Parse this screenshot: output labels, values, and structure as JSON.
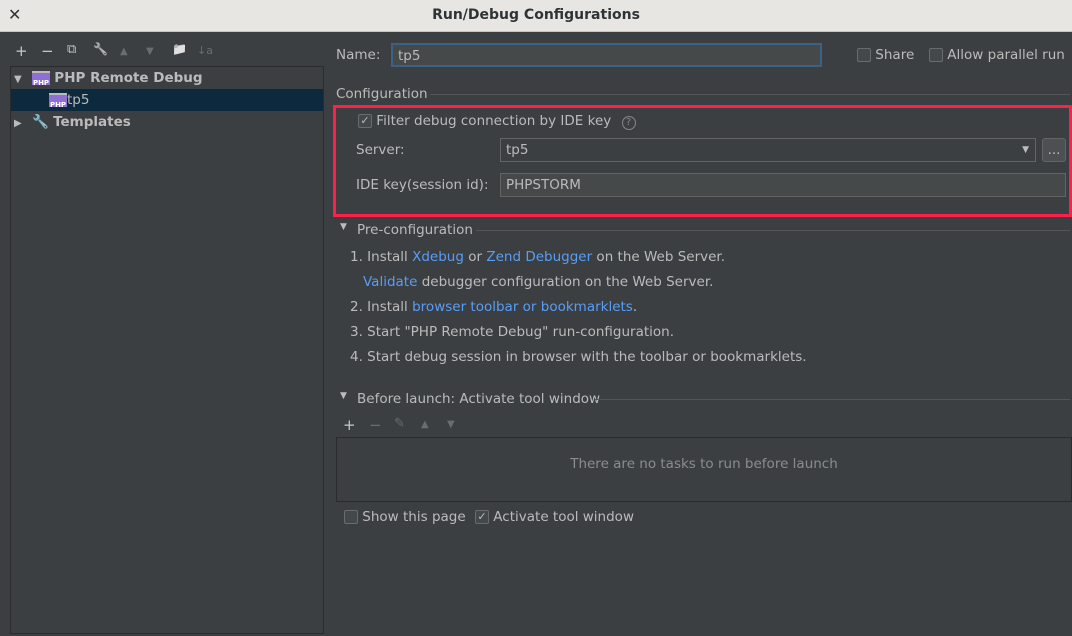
{
  "window": {
    "title": "Run/Debug Configurations"
  },
  "toolbar": {
    "add": "+",
    "remove": "−",
    "copy": "⧉",
    "edit": "🔧",
    "up": "▲",
    "down": "▼",
    "folder": "📁",
    "sort": "↓a"
  },
  "tree": {
    "group": "PHP Remote Debug",
    "item": "tp5",
    "templates": "Templates"
  },
  "name": {
    "label": "Name:",
    "value": "tp5"
  },
  "share": {
    "label": "Share",
    "checked": false
  },
  "parallel": {
    "label": "Allow parallel run",
    "checked": false
  },
  "configuration": {
    "title": "Configuration",
    "filter_label": "Filter debug connection by IDE key",
    "filter_checked": true,
    "server_label": "Server:",
    "server_value": "tp5",
    "more": "...",
    "idekey_label": "IDE key(session id):",
    "idekey_value": "PHPSTORM",
    "highlight_color": "#ff1f4b"
  },
  "preconfig": {
    "title": "Pre-configuration",
    "s1a": "1. Install ",
    "s1l1": "Xdebug",
    "s1b": " or ",
    "s1l2": "Zend Debugger",
    "s1c": " on the Web Server.",
    "s1v": "Validate",
    "s1d": " debugger configuration on the Web Server.",
    "s2a": "2. Install ",
    "s2l": "browser toolbar or bookmarklets",
    "s2b": ".",
    "s3": "3. Start \"PHP Remote Debug\" run-configuration.",
    "s4": "4. Start debug session in browser with the toolbar or bookmarklets."
  },
  "before_launch": {
    "title": "Before launch: Activate tool window",
    "empty": "There are no tasks to run before launch",
    "show_page": "Show this page",
    "show_page_checked": false,
    "activate": "Activate tool window",
    "activate_checked": true
  }
}
